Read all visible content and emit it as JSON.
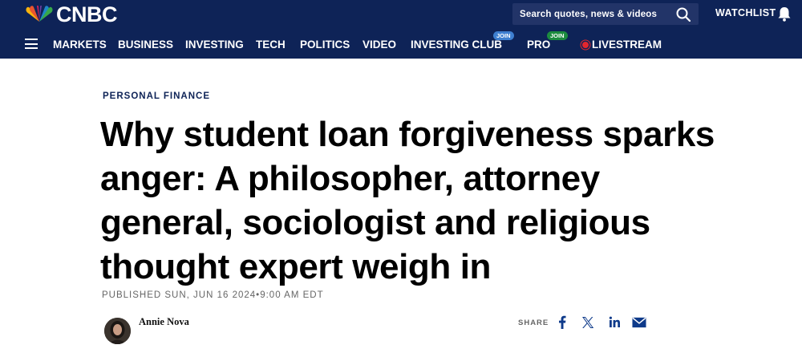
{
  "brand": {
    "name": "CNBC"
  },
  "search": {
    "placeholder": "Search quotes, news & videos"
  },
  "header": {
    "watchlist_label": "WATCHLIST"
  },
  "nav": {
    "items": [
      {
        "label": "MARKETS"
      },
      {
        "label": "BUSINESS"
      },
      {
        "label": "INVESTING"
      },
      {
        "label": "TECH"
      },
      {
        "label": "POLITICS"
      },
      {
        "label": "VIDEO"
      },
      {
        "label": "INVESTING CLUB",
        "badge": "JOIN"
      },
      {
        "label": "PRO",
        "badge": "JOIN"
      },
      {
        "label": "LIVESTREAM"
      }
    ]
  },
  "article": {
    "kicker": "PERSONAL FINANCE",
    "headline_lines": [
      "Why student loan forgiveness sparks",
      "anger: A philosopher, attorney",
      "general, sociologist and religious",
      "thought expert weigh in"
    ],
    "published": "PUBLISHED SUN, JUN 16 2024•9:00 AM EDT",
    "author": "Annie Nova"
  },
  "share": {
    "label": "SHARE",
    "icons": [
      "facebook-icon",
      "x-icon",
      "linkedin-icon",
      "email-icon"
    ]
  },
  "colors": {
    "header_bg": "#0e2357",
    "search_bg": "#223468",
    "join_blue": "#3e7fd0",
    "join_green": "#1c8b3f",
    "live_red": "#e3262e",
    "share_blue": "#0e3a8a"
  }
}
